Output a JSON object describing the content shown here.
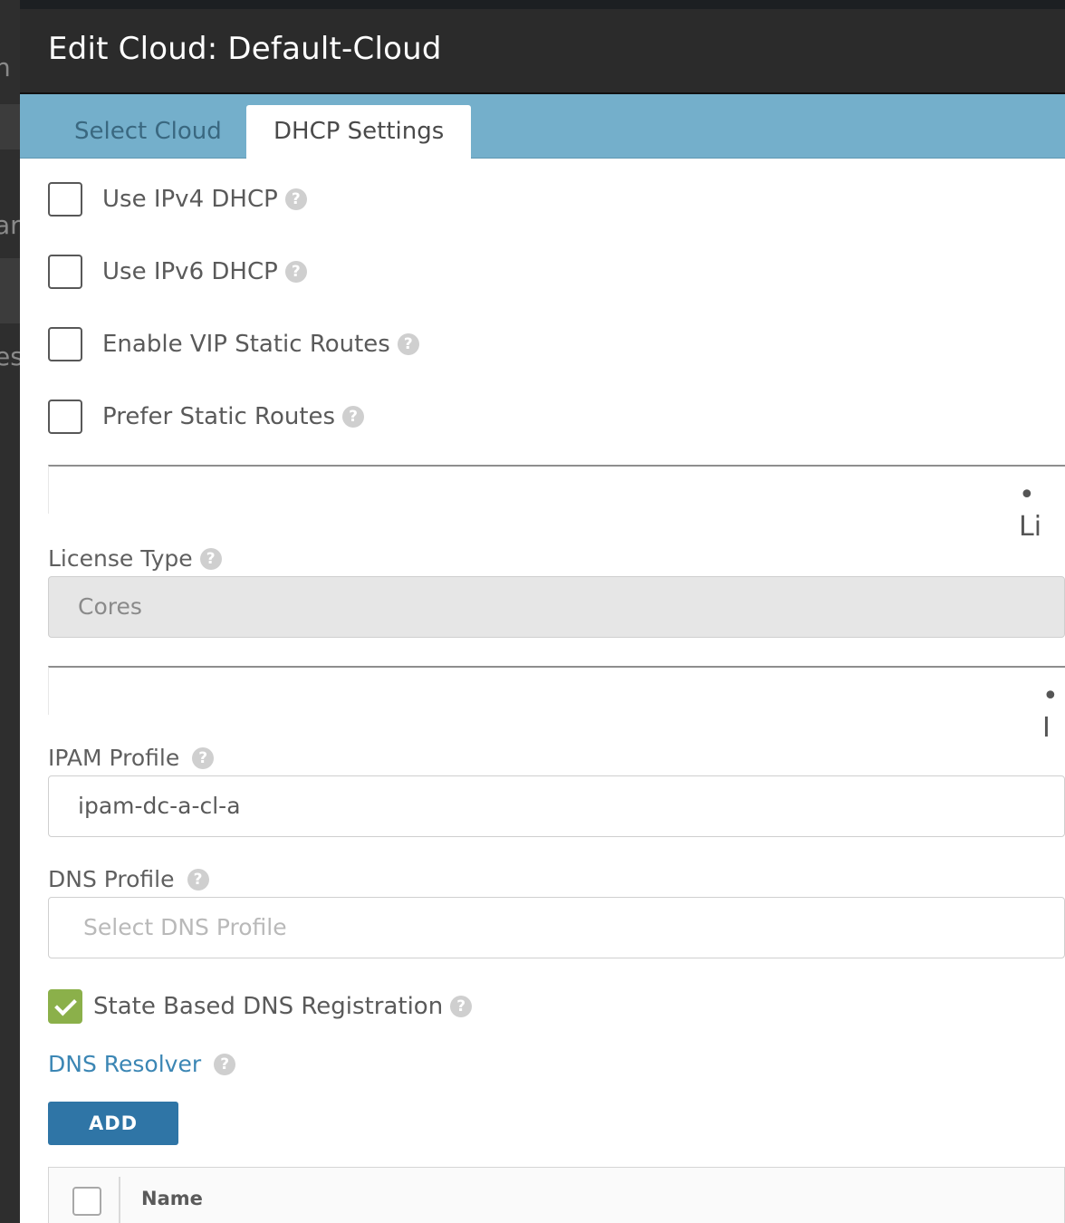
{
  "background_fragments": [
    "n",
    "ar",
    "es"
  ],
  "modal": {
    "title": "Edit Cloud: Default-Cloud",
    "tabs": [
      {
        "label": "Select Cloud",
        "active": false
      },
      {
        "label": "DHCP Settings",
        "active": true
      }
    ]
  },
  "options": [
    {
      "label": "Use IPv4 DHCP",
      "checked": false
    },
    {
      "label": "Use IPv6 DHCP",
      "checked": false
    },
    {
      "label": "Enable VIP Static Routes",
      "checked": false
    },
    {
      "label": "Prefer Static Routes",
      "checked": false
    }
  ],
  "section1": {
    "fragment": "• Li"
  },
  "license_type": {
    "label": "License Type",
    "value": "Cores"
  },
  "section2": {
    "fragment": "• I"
  },
  "ipam_profile": {
    "label": "IPAM Profile",
    "value": "ipam-dc-a-cl-a"
  },
  "dns_profile": {
    "label": "DNS Profile",
    "placeholder": "Select DNS Profile"
  },
  "state_dns": {
    "label": "State Based DNS Registration",
    "checked": true
  },
  "dns_resolver": {
    "label": "DNS Resolver",
    "add_label": "ADD"
  },
  "resolver_table": {
    "columns": [
      "Name"
    ]
  },
  "help_glyph": "?",
  "colors": {
    "header_bg": "#2b2b2b",
    "tab_bar": "#74afcb",
    "checked_green": "#8bb04a",
    "link_blue": "#3b86b4",
    "button_blue": "#2f75a6"
  }
}
